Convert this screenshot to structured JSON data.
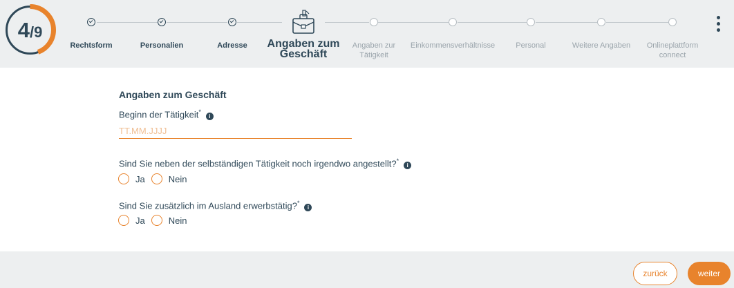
{
  "progress": {
    "current": "4",
    "separator": "/",
    "total": "9",
    "fraction": 0.444
  },
  "steps": [
    {
      "label": "Rechtsform",
      "status": "done"
    },
    {
      "label": "Personalien",
      "status": "done"
    },
    {
      "label": "Adresse",
      "status": "done"
    },
    {
      "label_line1": "Angaben zum",
      "label_line2": "Geschäft",
      "status": "active",
      "icon": "briefcase-icon"
    },
    {
      "label_line1": "Angaben zur",
      "label_line2": "Tätigkeit",
      "status": "todo"
    },
    {
      "label": "Einkommensverhältnisse",
      "status": "todo"
    },
    {
      "label": "Personal",
      "status": "todo"
    },
    {
      "label": "Weitere Angaben",
      "status": "todo"
    },
    {
      "label_line1": "Onlineplattform",
      "label_line2": "connect",
      "status": "todo"
    }
  ],
  "form": {
    "title": "Angaben zum Geschäft",
    "start_date": {
      "label": "Beginn der Tätigkeit",
      "required_mark": "*",
      "placeholder": "TT.MM.JJJJ",
      "value": ""
    },
    "employed": {
      "label": "Sind Sie neben der selbständigen Tätigkeit noch irgendwo angestellt?",
      "required_mark": "*",
      "options": [
        "Ja",
        "Nein"
      ]
    },
    "abroad": {
      "label": "Sind Sie zusätzlich im Ausland erwerbstätig?",
      "required_mark": "*",
      "options": [
        "Ja",
        "Nein"
      ]
    }
  },
  "footer": {
    "back_label": "zurück",
    "next_label": "weiter"
  },
  "colors": {
    "accent": "#e8832c",
    "text": "#2f4858",
    "header_bg": "#edeff0",
    "muted": "#9aa4ab"
  }
}
